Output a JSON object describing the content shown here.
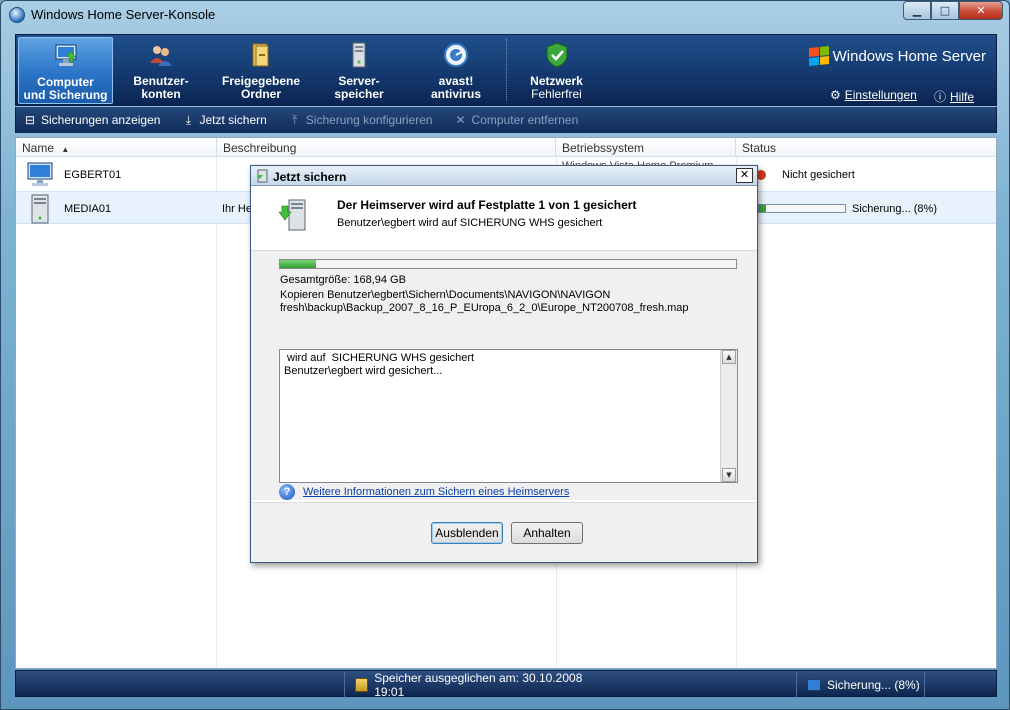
{
  "window": {
    "title": "Windows Home Server-Konsole",
    "controls": {
      "minimize": "▁",
      "maximize": "□",
      "close": "✕"
    }
  },
  "navbar": {
    "tabs": [
      {
        "label": "Computer\nund Sicherung",
        "icon": "computer-icon",
        "active": true
      },
      {
        "label": "Benutzer-\nkonten",
        "icon": "users-icon"
      },
      {
        "label": "Freigegebene\nOrdner",
        "icon": "folder-icon"
      },
      {
        "label": "Server-\nspeicher",
        "icon": "server-icon"
      },
      {
        "label": "avast!\nantivirus",
        "icon": "avast-icon"
      }
    ],
    "network": {
      "label": "Netzwerk",
      "status": "Fehlerfrei",
      "icon": "shield-check-icon"
    },
    "brand": "Windows Home Server",
    "settings_label": "Einstellungen",
    "help_label": "Hilfe"
  },
  "toolbar": {
    "items": [
      {
        "label": "Sicherungen anzeigen",
        "icon": "backups-icon",
        "enabled": true
      },
      {
        "label": "Jetzt sichern",
        "icon": "backup-now-icon",
        "enabled": true
      },
      {
        "label": "Sicherung konfigurieren",
        "icon": "configure-icon",
        "enabled": false
      },
      {
        "label": "Computer entfernen",
        "icon": "remove-icon",
        "enabled": false
      }
    ]
  },
  "table": {
    "columns": [
      "Name",
      "Beschreibung",
      "Betriebssystem",
      "Status"
    ],
    "rows": [
      {
        "name": "EGBERT01",
        "description": "",
        "os": "Windows Vista Home Premium",
        "status": "Nicht gesichert",
        "icon": "desktop-computer-icon"
      },
      {
        "name": "MEDIA01",
        "description": "Ihr He",
        "os": "",
        "status": "Sicherung... (8%)",
        "progress": 0.08,
        "icon": "tower-computer-icon",
        "selected": true
      }
    ]
  },
  "statusbar": {
    "balance": "Speicher ausgeglichen am: 30.10.2008 19:01",
    "backup": "Sicherung... (8%)"
  },
  "dialog": {
    "title": "Jetzt sichern",
    "heading": "Der Heimserver wird auf Festplatte 1 von 1 gesichert",
    "subheading": "Benutzer\\egbert wird auf  SICHERUNG WHS gesichert",
    "progress": 0.08,
    "total_size": "Gesamtgröße: 168,94 GB",
    "copying": "Kopieren Benutzer\\egbert\\Sichern\\Documents\\NAVIGON\\NAVIGON\nfresh\\backup\\Backup_2007_8_16_P_EUropa_6_2_0\\Europe_NT200708_fresh.map",
    "log": [
      " wird auf  SICHERUNG WHS gesichert",
      "Benutzer\\egbert wird gesichert..."
    ],
    "help_link": "Weitere Informationen zum Sichern eines Heimservers",
    "buttons": {
      "hide": "Ausblenden",
      "stop": "Anhalten"
    }
  },
  "colors": {
    "nav_dark": "#173e75",
    "nav_active": "#2b74c7",
    "progress_green": "#2e9e2e",
    "link": "#0b3fa8"
  }
}
